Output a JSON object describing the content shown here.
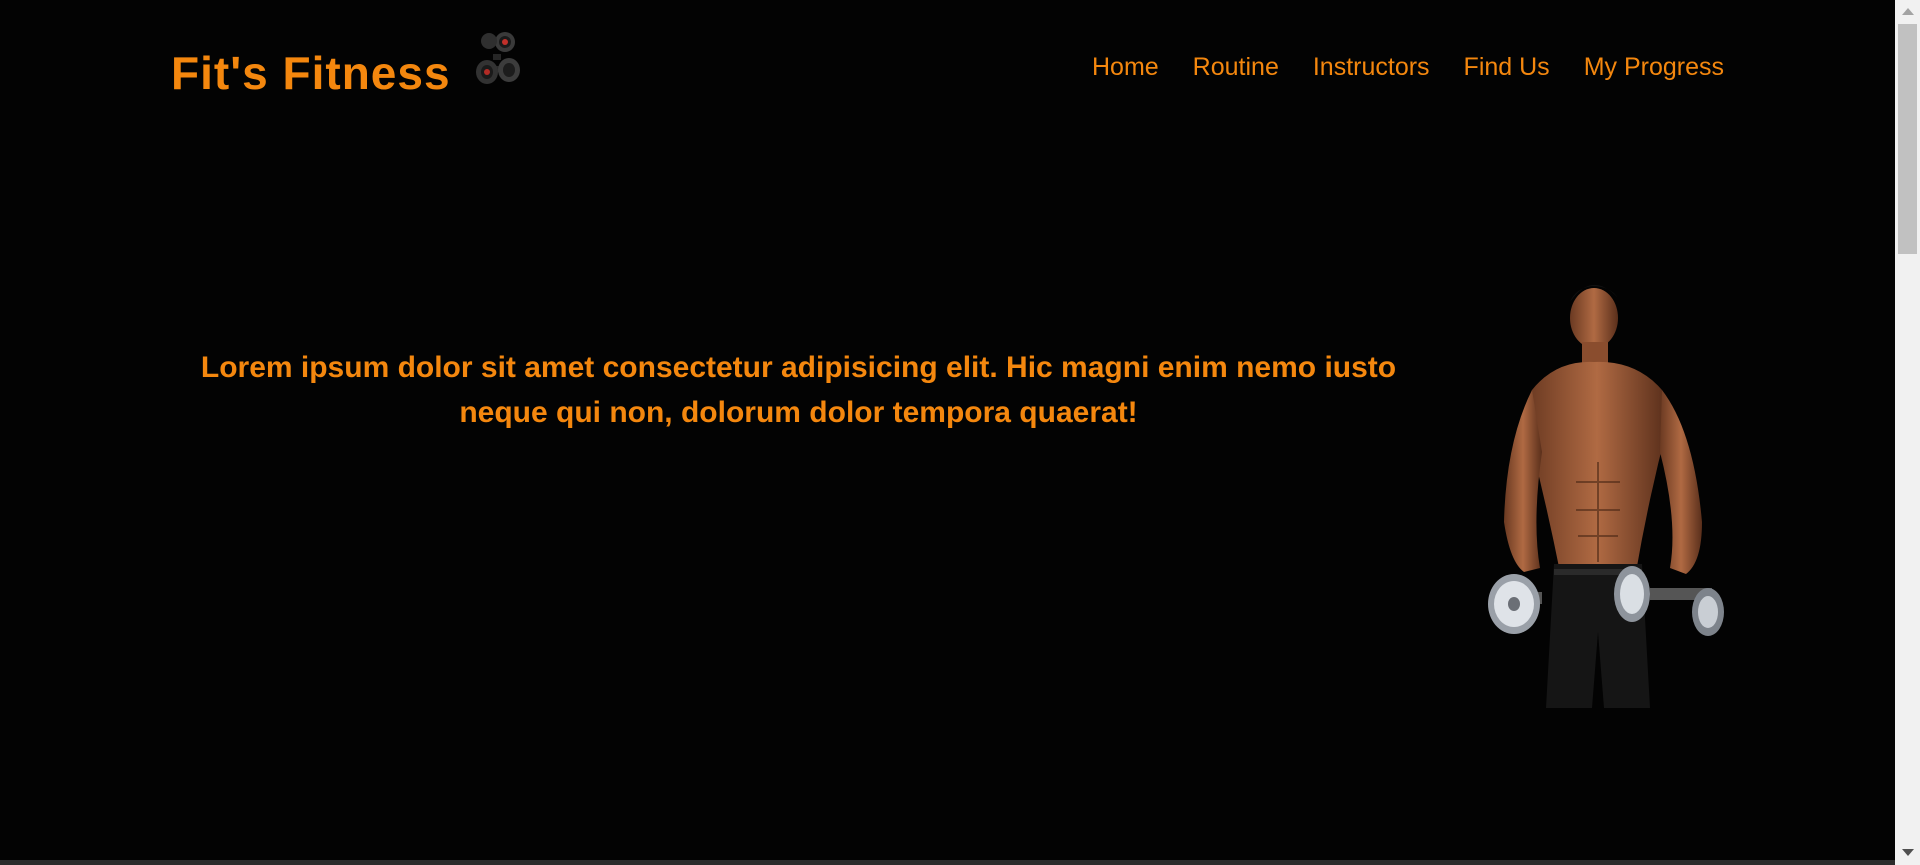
{
  "header": {
    "brand_title": "Fit's Fitness",
    "logo_icon": "dumbbell-icon"
  },
  "nav": {
    "items": [
      {
        "label": "Home"
      },
      {
        "label": "Routine"
      },
      {
        "label": "Instructors"
      },
      {
        "label": "Find Us"
      },
      {
        "label": "My Progress"
      }
    ]
  },
  "hero": {
    "text": "Lorem ipsum dolor sit amet consectetur adipisicing elit. Hic magni enim nemo iusto neque qui non, dolorum dolor tempora quaerat!",
    "image": "athlete-with-dumbbells"
  },
  "colors": {
    "accent": "#f4870e",
    "background": "#030303"
  }
}
